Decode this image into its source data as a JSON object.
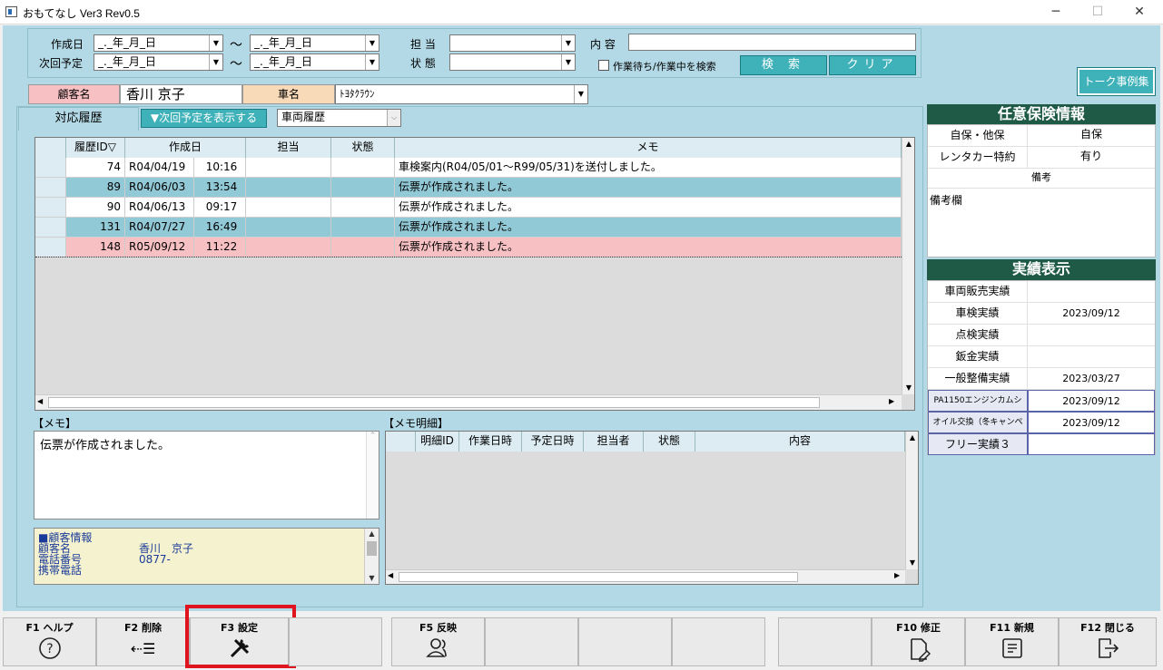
{
  "window": {
    "title": "おもてなし Ver3 Rev0.5",
    "minimize": "─",
    "maximize": "☐",
    "close": "✕"
  },
  "filter": {
    "created_label": "作成日",
    "next_label": "次回予定",
    "date_placeholder": "_._年_月_日",
    "tilde": "〜",
    "staff_label": "担 当",
    "status_label": "状 態",
    "content_label": "内 容",
    "waiting_checkbox": "作業待ち/作業中を検索",
    "search_btn": "検 索",
    "clear_btn": "クリア"
  },
  "customer": {
    "name_label": "顧客名",
    "name": "香川 京子",
    "car_label": "車名",
    "car": "ﾄﾖﾀｸﾗｳﾝ"
  },
  "talk_btn": "トーク事例集",
  "tabs": {
    "history": "対応履歴",
    "show_next": "▼次回予定を表示する",
    "view_select": "車両履歴"
  },
  "history": {
    "columns": [
      "履歴ID▽",
      "作成日",
      "担当",
      "状態",
      "メモ"
    ],
    "rows": [
      {
        "id": "74",
        "date": "R04/04/19",
        "time": "10:16",
        "staff": "",
        "status": "",
        "memo": "車検案内(R04/05/01〜R99/05/31)を送付しました。"
      },
      {
        "id": "89",
        "date": "R04/06/03",
        "time": "13:54",
        "staff": "",
        "status": "",
        "memo": "伝票が作成されました。"
      },
      {
        "id": "90",
        "date": "R04/06/13",
        "time": "09:17",
        "staff": "",
        "status": "",
        "memo": "伝票が作成されました。"
      },
      {
        "id": "131",
        "date": "R04/07/27",
        "time": "16:49",
        "staff": "",
        "status": "",
        "memo": "伝票が作成されました。"
      },
      {
        "id": "148",
        "date": "R05/09/12",
        "time": "11:22",
        "staff": "",
        "status": "",
        "memo": "伝票が作成されました。"
      }
    ]
  },
  "memo": {
    "label": "【メモ】",
    "text": "伝票が作成されました。"
  },
  "memo_detail": {
    "label": "【メモ明細】",
    "columns": [
      "明細ID",
      "作業日時",
      "予定日時",
      "担当者",
      "状態",
      "内容"
    ]
  },
  "customer_info": {
    "title": "■顧客情報",
    "l1": "顧客名",
    "v1": "香川　京子",
    "l2": "電話番号",
    "v2": "0877-",
    "l3": "携帯電話",
    "v3": ""
  },
  "insurance": {
    "title": "任意保険情報",
    "r1_label": "自保・他保",
    "r1_value": "自保",
    "r2_label": "レンタカー特約",
    "r2_value": "有り",
    "note_label": "備考",
    "note": "備考欄"
  },
  "results": {
    "title": "実績表示",
    "rows": [
      {
        "label": "車両販売実績",
        "value": ""
      },
      {
        "label": "車検実績",
        "value": "2023/09/12"
      },
      {
        "label": "点検実績",
        "value": ""
      },
      {
        "label": "鈑金実績",
        "value": ""
      },
      {
        "label": "一般整備実績",
        "value": "2023/03/27"
      },
      {
        "label": "PA1150エンジンカムシ",
        "value": "2023/09/12"
      },
      {
        "label": "オイル交換（冬キャンペ",
        "value": "2023/09/12"
      },
      {
        "label": "フリー実績３",
        "value": ""
      }
    ]
  },
  "fkeys": {
    "f1": "F1 ヘルプ",
    "f2": "F2 削除",
    "f3": "F3 設定",
    "f5": "F5 反映",
    "f10": "F10 修正",
    "f11": "F11 新規",
    "f12": "F12 閉じる"
  },
  "colors": {
    "bg": "#b3d9e6",
    "accent_teal": "#3fb1b9",
    "dark_green": "#1e5a46",
    "row_alt": "#92c9d6",
    "row_pink": "#f7c1c4",
    "highlight_red": "#e0141e"
  }
}
